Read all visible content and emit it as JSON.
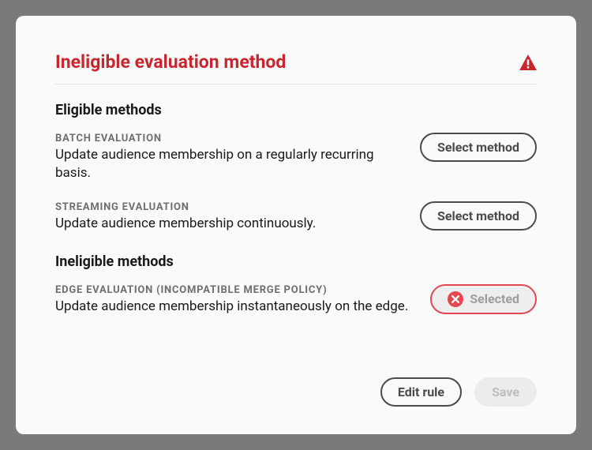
{
  "header": {
    "title": "Ineligible evaluation method"
  },
  "sections": {
    "eligible_heading": "Eligible methods",
    "ineligible_heading": "Ineligible methods"
  },
  "methods": {
    "batch": {
      "label": "BATCH EVALUATION",
      "desc": "Update audience membership on a regularly recurring basis.",
      "button": "Select method"
    },
    "streaming": {
      "label": "STREAMING EVALUATION",
      "desc": "Update audience membership continuously.",
      "button": "Select method"
    },
    "edge": {
      "label": "EDGE EVALUATION (INCOMPATIBLE MERGE POLICY)",
      "desc": "Update audience membership instantaneously on the edge.",
      "button": "Selected"
    }
  },
  "footer": {
    "edit_rule": "Edit rule",
    "save": "Save"
  }
}
